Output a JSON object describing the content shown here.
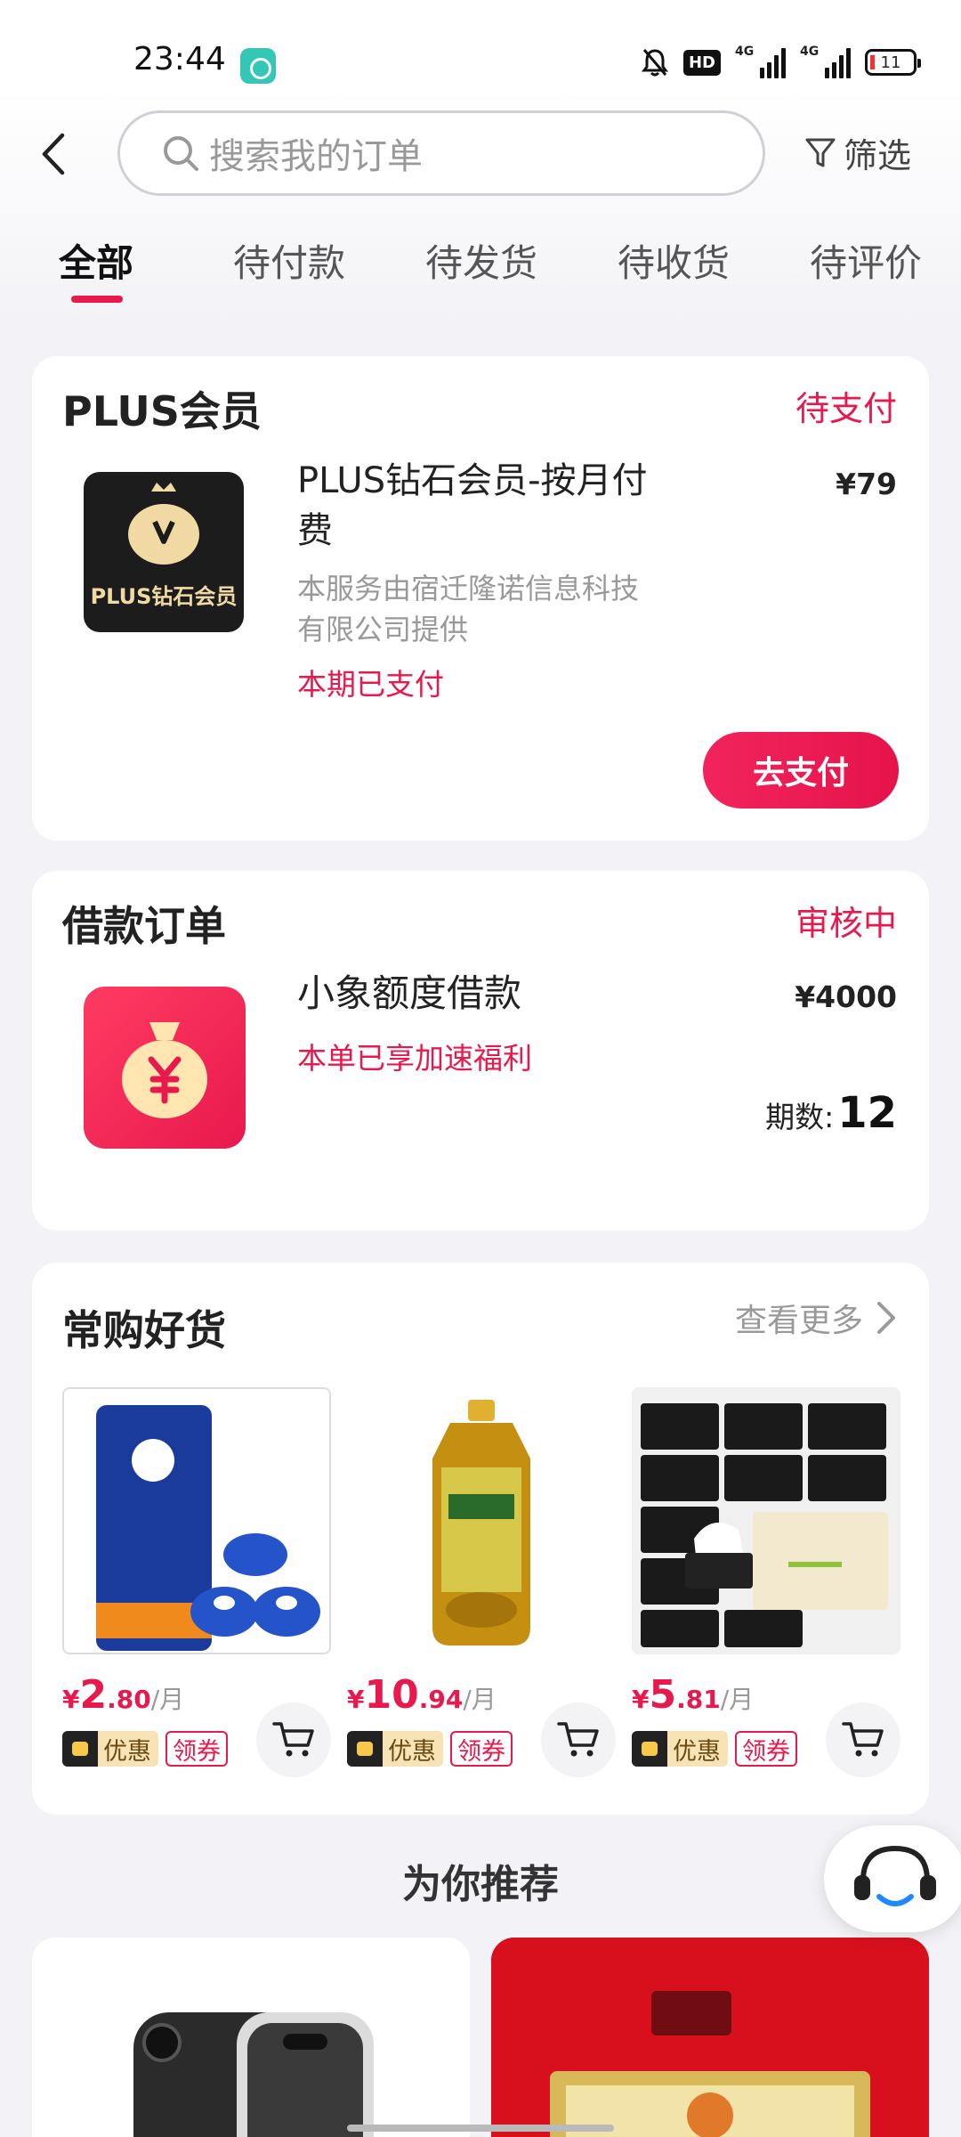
{
  "status_bar": {
    "time": "23:44",
    "hd_label": "HD",
    "network_1": "4G",
    "network_2": "4G",
    "battery": "11",
    "icons": [
      "app-notification-icon",
      "mute-bell-icon",
      "signal-icon",
      "battery-icon"
    ]
  },
  "search": {
    "placeholder": "搜索我的订单"
  },
  "filter": {
    "label": "筛选"
  },
  "tabs": [
    {
      "label": "全部",
      "active": true
    },
    {
      "label": "待付款",
      "active": false
    },
    {
      "label": "待发货",
      "active": false
    },
    {
      "label": "待收货",
      "active": false
    },
    {
      "label": "待评价",
      "active": false
    }
  ],
  "orders": {
    "plus": {
      "title": "PLUS会员",
      "status": "待支付",
      "logo_text": "PLUS钻石会员",
      "name_line1": "PLUS钻石会员-按月付",
      "name_line2": "费",
      "sub_line1": "本服务由宿迁隆诺信息科技",
      "sub_line2": "有限公司提供",
      "note": "本期已支付",
      "price": "¥79",
      "pay_label": "去支付"
    },
    "loan": {
      "title": "借款订单",
      "status": "审核中",
      "name": "小象额度借款",
      "note": "本单已享加速福利",
      "price": "¥4000",
      "periods_label": "期数:",
      "periods_value": "12"
    }
  },
  "frequent": {
    "title": "常购好货",
    "see_more": "查看更多",
    "items": [
      {
        "sym": "¥",
        "int": "2",
        "dec": ".80",
        "per": "/月",
        "tag1": "优惠",
        "tag2": "领券"
      },
      {
        "sym": "¥",
        "int": "10",
        "dec": ".94",
        "per": "/月",
        "tag1": "优惠",
        "tag2": "领券"
      },
      {
        "sym": "¥",
        "int": "5",
        "dec": ".81",
        "per": "/月",
        "tag1": "优惠",
        "tag2": "领券"
      }
    ]
  },
  "recommend": {
    "title": "为你推荐"
  },
  "colors": {
    "accent": "#e8194d",
    "background": "#f3f3f7"
  }
}
